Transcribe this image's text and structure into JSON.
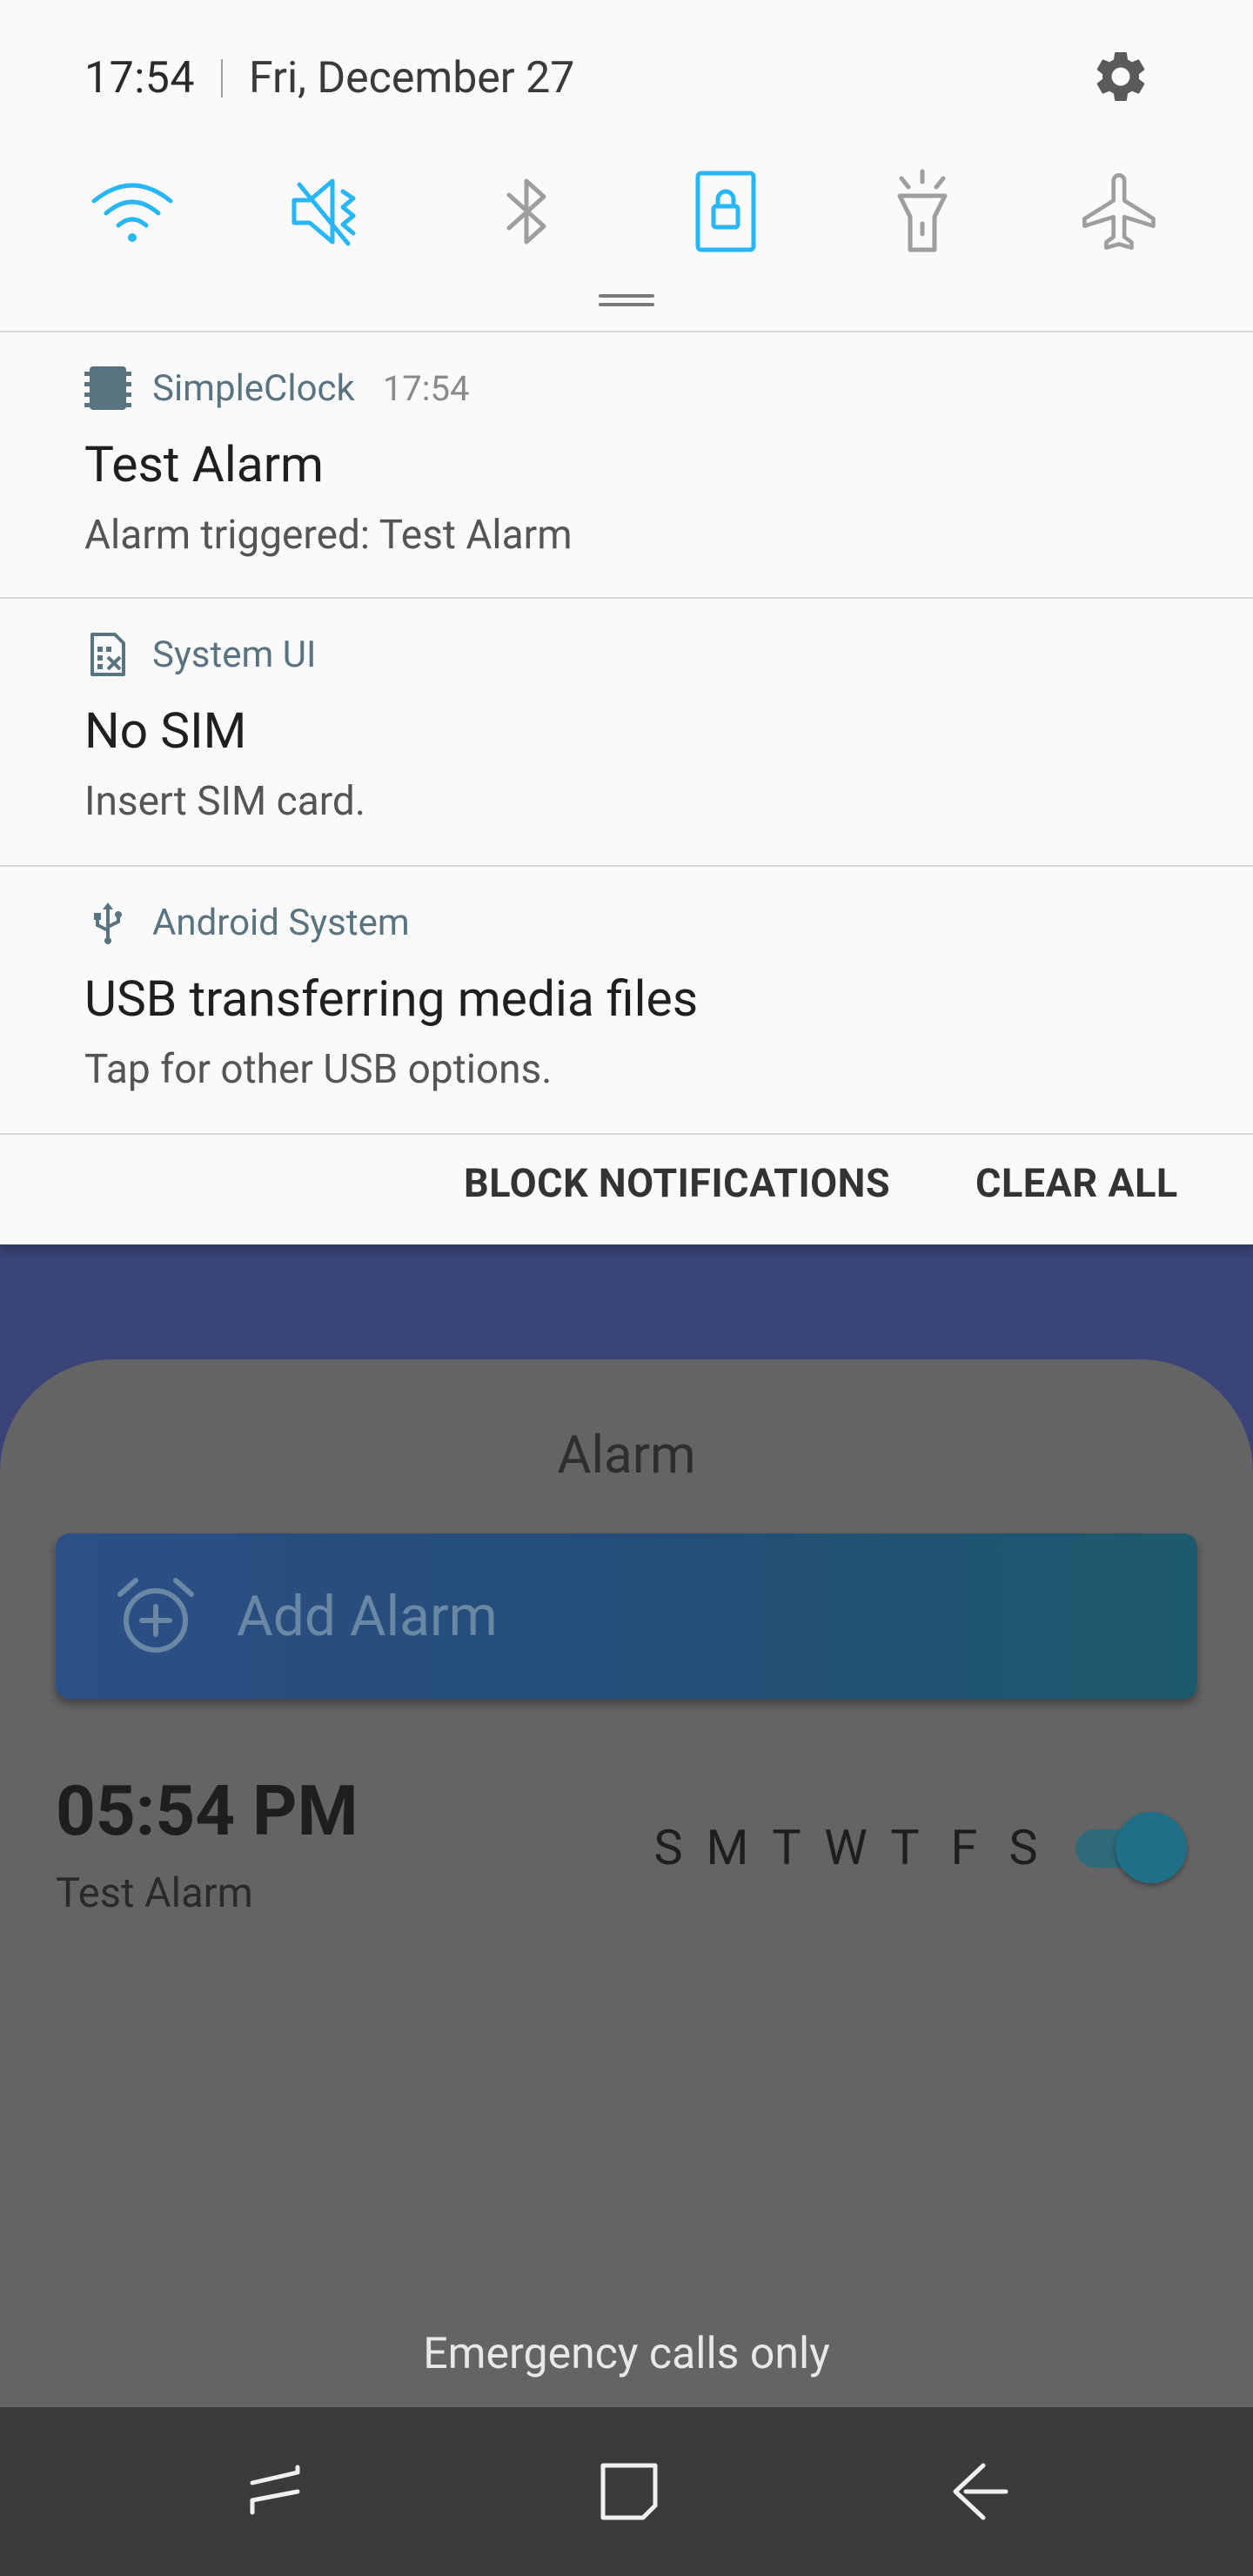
{
  "status": {
    "time": "17:54",
    "date": "Fri, December 27"
  },
  "quick_settings": [
    {
      "name": "wifi-icon",
      "active": true
    },
    {
      "name": "sound-mute-icon",
      "active": true
    },
    {
      "name": "bluetooth-icon",
      "active": false
    },
    {
      "name": "screen-lock-icon",
      "active": true
    },
    {
      "name": "flashlight-icon",
      "active": false
    },
    {
      "name": "airplane-icon",
      "active": false
    }
  ],
  "notifications": [
    {
      "app": "SimpleClock",
      "time": "17:54",
      "title": "Test Alarm",
      "body": "Alarm triggered: Test Alarm",
      "icon": "clock-chip-icon"
    },
    {
      "app": "System UI",
      "time": "",
      "title": "No SIM",
      "body": "Insert SIM card.",
      "icon": "sim-card-icon"
    },
    {
      "app": "Android System",
      "time": "",
      "title": "USB transferring media files",
      "body": "Tap for other USB options.",
      "icon": "usb-icon"
    }
  ],
  "actions": {
    "block": "BLOCK NOTIFICATIONS",
    "clear": "CLEAR ALL"
  },
  "app": {
    "heading": "Alarm",
    "add_alarm": "Add Alarm",
    "alarm": {
      "time": "05:54 PM",
      "label": "Test Alarm",
      "days": [
        "S",
        "M",
        "T",
        "W",
        "T",
        "F",
        "S"
      ],
      "enabled": true
    }
  },
  "emergency": "Emergency calls only",
  "colors": {
    "accent": "#29b6f6",
    "inactive": "#9e9e9e",
    "shade_bg": "#fafafa",
    "app_name": "#5a7380"
  }
}
